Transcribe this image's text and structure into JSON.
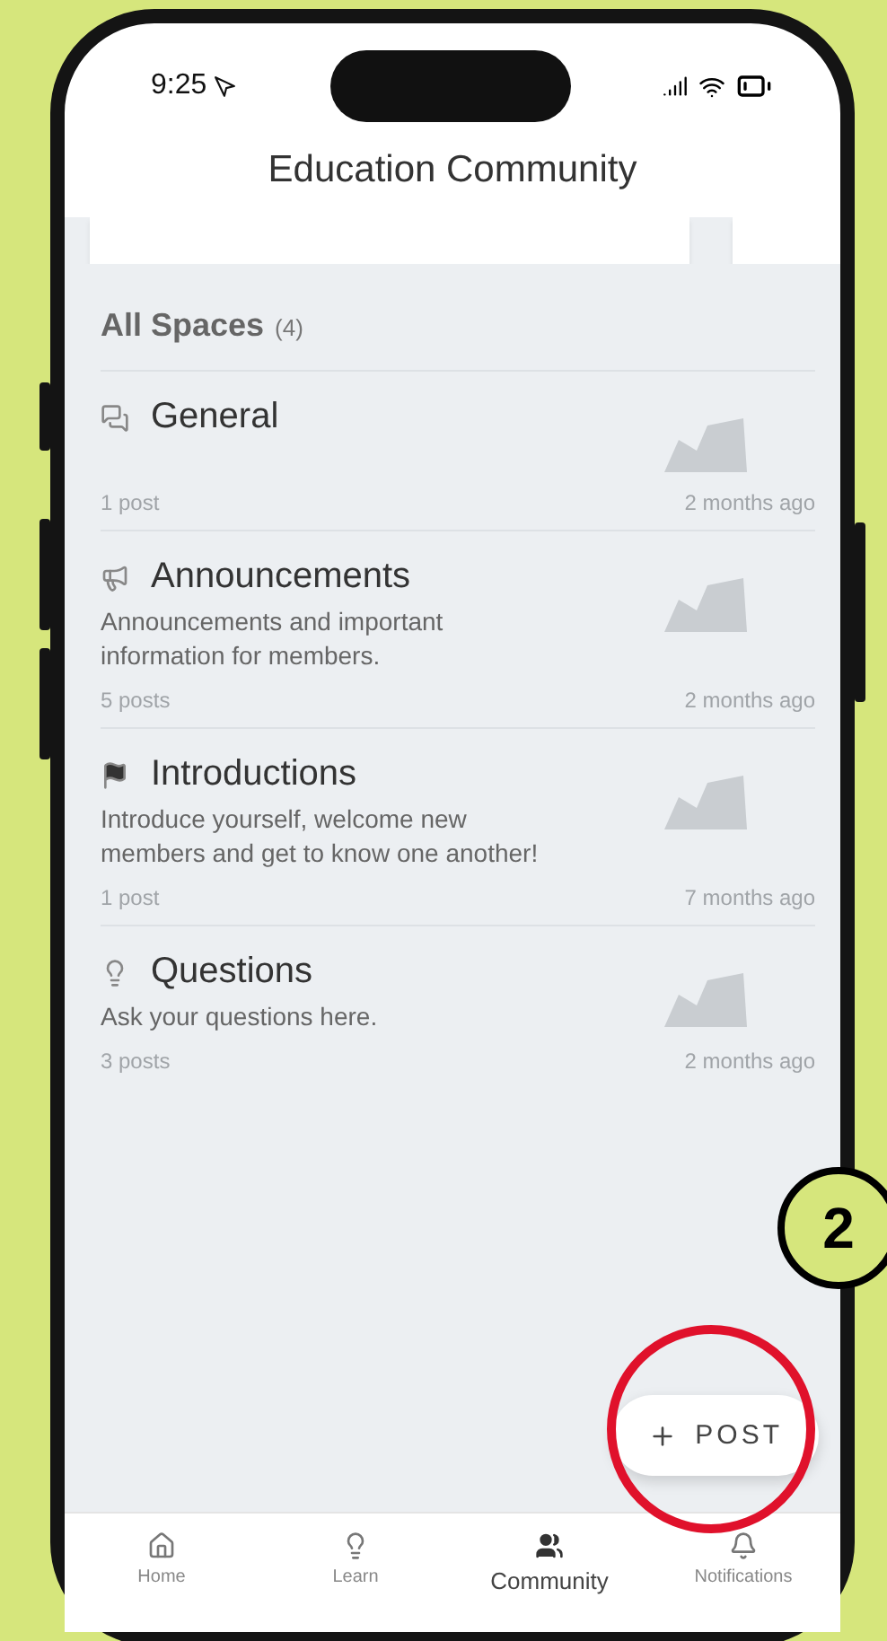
{
  "status_bar": {
    "time": "9:25"
  },
  "header": {
    "title": "Education Community"
  },
  "section": {
    "title": "All Spaces",
    "count": "(4)"
  },
  "spaces": [
    {
      "kind": "chat",
      "name": "General",
      "posts": "1 post",
      "updated": "2 months ago"
    },
    {
      "kind": "megaphone",
      "name": "Announcements",
      "description": "Announcements and important information for members.",
      "posts": "5 posts",
      "updated": "2 months ago"
    },
    {
      "kind": "flag",
      "name": "Introductions",
      "description": "Introduce yourself, welcome new members and get to know one another!",
      "posts": "1 post",
      "updated": "7 months ago"
    },
    {
      "kind": "bulb",
      "name": "Questions",
      "description": "Ask your questions here.",
      "posts": "3 posts",
      "updated": "2 months ago"
    }
  ],
  "post_button": {
    "label": "POST"
  },
  "nav": [
    {
      "kind": "home",
      "label": "Home",
      "selected": false
    },
    {
      "kind": "learn",
      "label": "Learn",
      "selected": false
    },
    {
      "kind": "community",
      "label": "Community",
      "selected": true
    },
    {
      "kind": "bell",
      "label": "Notifications",
      "selected": false
    }
  ],
  "callout": {
    "number": "2"
  }
}
